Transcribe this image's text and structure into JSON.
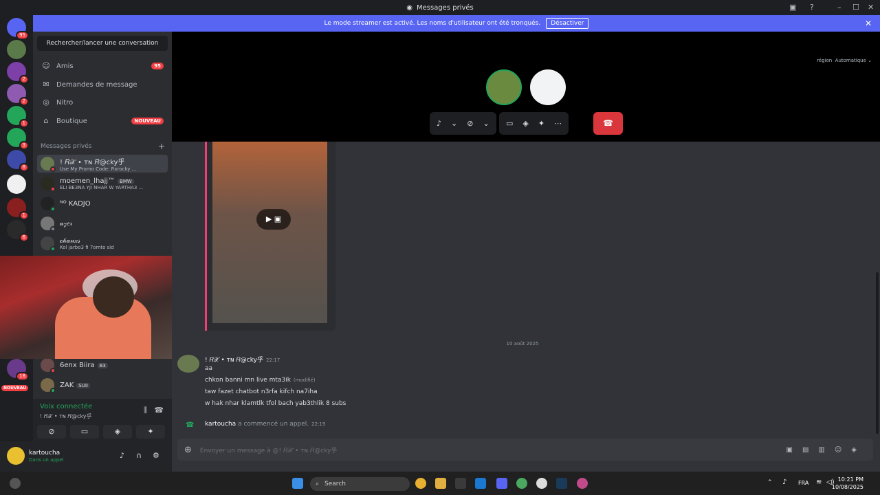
{
  "window": {
    "title": "Messages privés"
  },
  "banner": {
    "text": "Le mode streamer est activé. Les noms d'utilisateur ont été tronqués.",
    "button": "Désactiver"
  },
  "guilds": {
    "badges": [
      "95",
      "2",
      "2",
      "1",
      "3",
      "8",
      "1",
      "6",
      "18"
    ],
    "nouveau": "NOUVEAU"
  },
  "sidebar": {
    "search_placeholder": "Rechercher/lancer une conversation",
    "nav": [
      {
        "label": "Amis",
        "icon": "friends-icon",
        "badge": "95"
      },
      {
        "label": "Demandes de message",
        "icon": "mail-icon"
      },
      {
        "label": "Nitro",
        "icon": "nitro-icon"
      },
      {
        "label": "Boutique",
        "icon": "shop-icon",
        "badge": "NOUVEAU"
      }
    ],
    "dm_header": "Messages privés",
    "dms": [
      {
        "name": "! 𝑅𝒳 • ᴛɴ 𝑅@cky乎",
        "sub": "Use My Promo Code: Rxrocky ..."
      },
      {
        "name": "moemen_lhajj™",
        "tag": "BMW",
        "sub": "ELI BE3NA YJI NHAR W YARTHA3 ..."
      },
      {
        "name": "ᴺᴼ KADJO",
        "sub": ""
      },
      {
        "name": "𝒶𝓏𝑒𝓇",
        "sub": ""
      },
      {
        "name": "𝒸𝒽𝒶𝓃𝓍𝓈",
        "sub": "Kol jarbo3 fi 7omto sid"
      },
      {
        "name": "6enx Biira",
        "tag": "B3",
        "sub": ""
      },
      {
        "name": "ZAK",
        "tag": "SUII",
        "sub": ""
      }
    ]
  },
  "voice": {
    "status": "Voix connectée",
    "channel": "! 𝑅𝒳 • ᴛɴ 𝑅@cky乎"
  },
  "user": {
    "name": "kartoucha",
    "status": "Dans un appel"
  },
  "call": {
    "region_label": "région",
    "region_value": "Automatique"
  },
  "chat": {
    "date": "10 août 2025",
    "author": "! 𝑅𝒳 • ᴛɴ 𝑅@cky乎",
    "time": "22:17",
    "lines": [
      "aa",
      "chkon banni mn live mta3ik",
      "taw fazet chatbot n3rfa kifch na7iha",
      "w hak nhar klamtlk tfol bach yab3thlik 8 subs"
    ],
    "edited": "(modifié)",
    "call_user": "kartoucha",
    "call_text": "a commencé un appel.",
    "call_time": "22:19",
    "composer_placeholder": "Envoyer un message à @! 𝑅𝒳 • ᴛɴ 𝑅@cky乎"
  },
  "taskbar": {
    "search": "Search",
    "lang": "FRA",
    "time": "10:21 PM",
    "date": "10/08/2025"
  }
}
